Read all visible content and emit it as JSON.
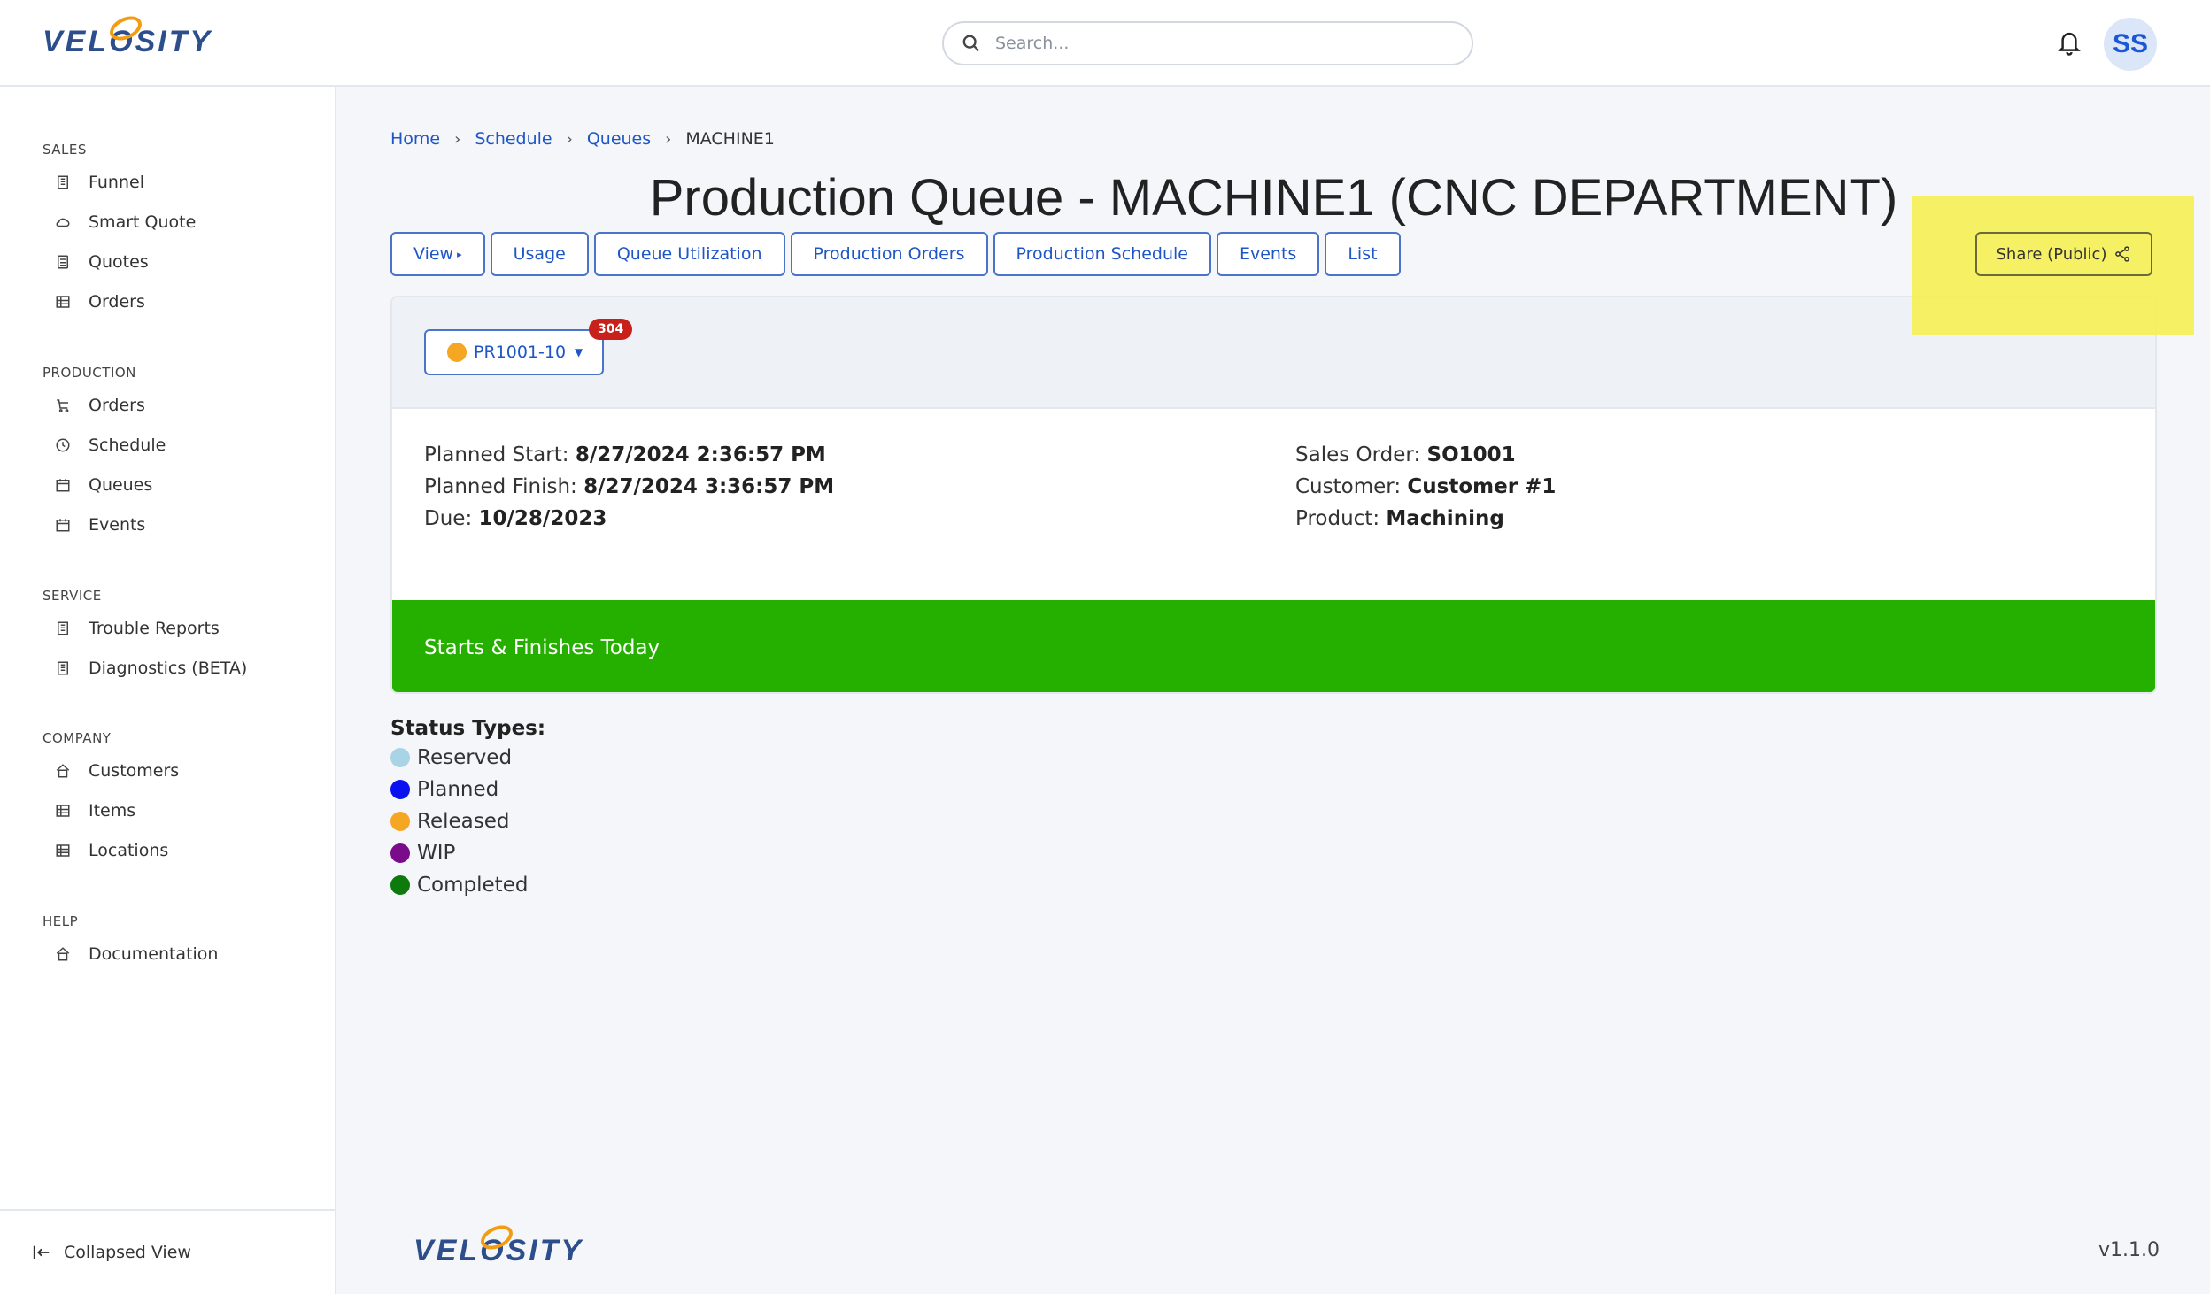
{
  "brand": {
    "logo_text_a": "VEL",
    "logo_text_o": "O",
    "logo_text_b": "SITY"
  },
  "search": {
    "placeholder": "Search..."
  },
  "user": {
    "initials": "SS"
  },
  "sidebar": {
    "sections": [
      {
        "title": "SALES",
        "items": [
          {
            "label": "Funnel",
            "icon": "building-icon"
          },
          {
            "label": "Smart Quote",
            "icon": "cloud-icon"
          },
          {
            "label": "Quotes",
            "icon": "calculator-icon"
          },
          {
            "label": "Orders",
            "icon": "grid-icon"
          }
        ]
      },
      {
        "title": "PRODUCTION",
        "items": [
          {
            "label": "Orders",
            "icon": "cart-icon"
          },
          {
            "label": "Schedule",
            "icon": "clock-icon"
          },
          {
            "label": "Queues",
            "icon": "calendar-icon"
          },
          {
            "label": "Events",
            "icon": "calendar-icon"
          }
        ]
      },
      {
        "title": "SERVICE",
        "items": [
          {
            "label": "Trouble Reports",
            "icon": "building-icon"
          },
          {
            "label": "Diagnostics (BETA)",
            "icon": "building-icon"
          }
        ]
      },
      {
        "title": "COMPANY",
        "items": [
          {
            "label": "Customers",
            "icon": "home-icon"
          },
          {
            "label": "Items",
            "icon": "grid-icon"
          },
          {
            "label": "Locations",
            "icon": "grid-icon"
          }
        ]
      },
      {
        "title": "HELP",
        "items": [
          {
            "label": "Documentation",
            "icon": "home-icon"
          }
        ]
      }
    ],
    "collapsed_label": "Collapsed View"
  },
  "breadcrumb": {
    "items": [
      "Home",
      "Schedule",
      "Queues"
    ],
    "current": "MACHINE1"
  },
  "page": {
    "title": "Production Queue - MACHINE1 (CNC DEPARTMENT)"
  },
  "tabs": [
    "View",
    "Usage",
    "Queue Utilization",
    "Production Orders",
    "Production Schedule",
    "Events",
    "List"
  ],
  "share": {
    "label": "Share (Public)"
  },
  "order": {
    "id": "PR1001-10",
    "badge": "304",
    "status_color": "#f5a623",
    "planned_start_label": "Planned Start:",
    "planned_start": "8/27/2024 2:36:57 PM",
    "planned_finish_label": "Planned Finish:",
    "planned_finish": "8/27/2024 3:36:57 PM",
    "due_label": "Due:",
    "due": "10/28/2023",
    "sales_order_label": "Sales Order:",
    "sales_order": "SO1001",
    "customer_label": "Customer:",
    "customer": "Customer #1",
    "product_label": "Product:",
    "product": "Machining",
    "status_text": "Starts & Finishes Today",
    "status_bar_color": "#25b000"
  },
  "status_types": {
    "title": "Status Types:",
    "items": [
      {
        "label": "Reserved",
        "color": "#a8d4e6"
      },
      {
        "label": "Planned",
        "color": "#0a10f0"
      },
      {
        "label": "Released",
        "color": "#f5a623"
      },
      {
        "label": "WIP",
        "color": "#7a0c8c"
      },
      {
        "label": "Completed",
        "color": "#0d7a0d"
      }
    ]
  },
  "footer": {
    "version": "v1.1.0"
  }
}
